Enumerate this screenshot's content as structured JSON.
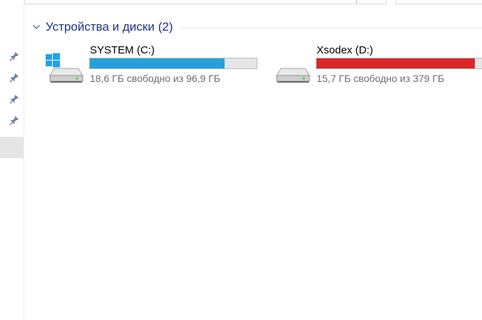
{
  "group": {
    "title": "Устройства и диски",
    "count": "(2)"
  },
  "nav": {
    "pins": [
      "pin-icon",
      "pin-icon",
      "pin-icon",
      "pin-icon"
    ]
  },
  "drives": [
    {
      "name": "SYSTEM (C:)",
      "free_text": "18,6 ГБ свободно из 96,9 ГБ",
      "used_fraction": 0.808,
      "bar_color": "#26a0da",
      "icon": "windows-system-drive-icon"
    },
    {
      "name": "Xsodex (D:)",
      "free_text": "15,7 ГБ свободно из 379 ГБ",
      "used_fraction": 0.959,
      "bar_color": "#da2626",
      "icon": "hard-drive-icon"
    }
  ],
  "colors": {
    "header_text": "#1e3287",
    "bar_normal": "#26a0da",
    "bar_full": "#da2626",
    "bar_track": "#e6e6e6",
    "secondary_text": "#6d6d6d"
  }
}
